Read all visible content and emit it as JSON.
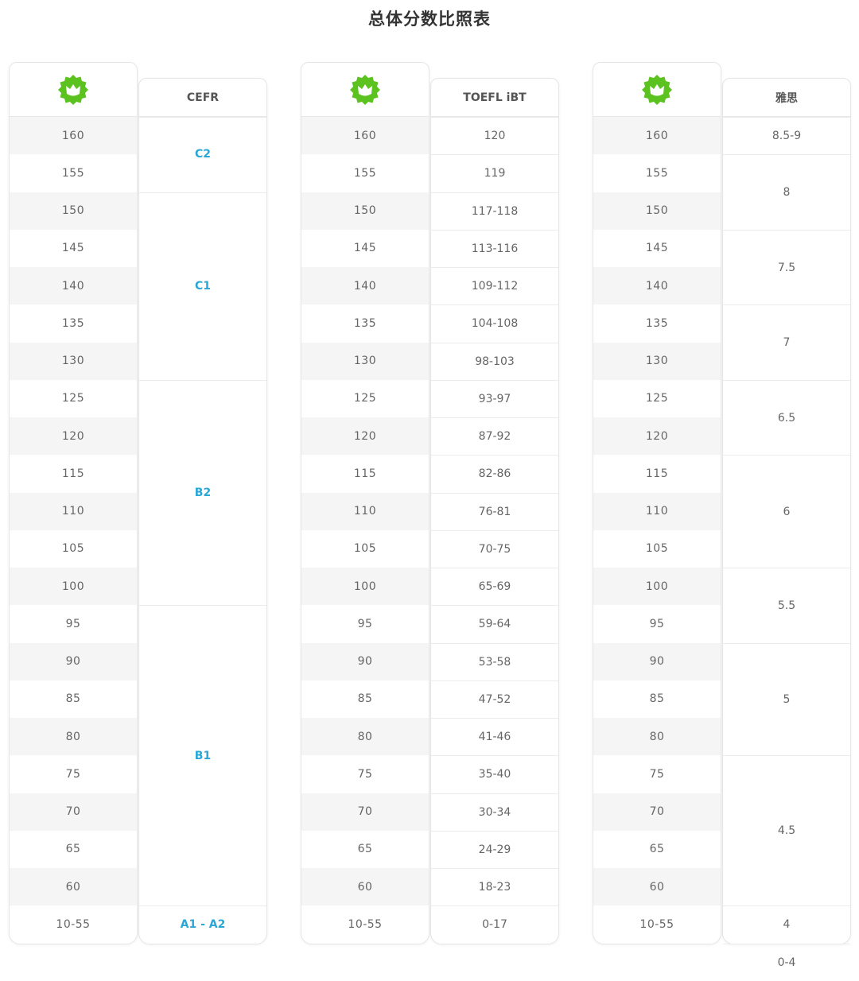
{
  "title": "总体分数比照表",
  "scores": [
    "160",
    "155",
    "150",
    "145",
    "140",
    "135",
    "130",
    "125",
    "120",
    "115",
    "110",
    "105",
    "100",
    "95",
    "90",
    "85",
    "80",
    "75",
    "70",
    "65",
    "60",
    "10-55"
  ],
  "accent": "#29a8d8",
  "logo_color": "#5cc21f",
  "tables": [
    {
      "header": "CEFR",
      "cells": [
        {
          "label": "C2",
          "span": 2
        },
        {
          "label": "C1",
          "span": 5
        },
        {
          "label": "B2",
          "span": 6
        },
        {
          "label": "B1",
          "span": 8
        },
        {
          "label": "A1 - A2",
          "span": 1
        }
      ]
    },
    {
      "header": "TOEFL iBT",
      "cells": [
        {
          "label": "120",
          "span": 1
        },
        {
          "label": "119",
          "span": 1
        },
        {
          "label": "117-118",
          "span": 1
        },
        {
          "label": "113-116",
          "span": 1
        },
        {
          "label": "109-112",
          "span": 1
        },
        {
          "label": "104-108",
          "span": 1
        },
        {
          "label": "98-103",
          "span": 1
        },
        {
          "label": "93-97",
          "span": 1
        },
        {
          "label": "87-92",
          "span": 1
        },
        {
          "label": "82-86",
          "span": 1
        },
        {
          "label": "76-81",
          "span": 1
        },
        {
          "label": "70-75",
          "span": 1
        },
        {
          "label": "65-69",
          "span": 1
        },
        {
          "label": "59-64",
          "span": 1
        },
        {
          "label": "53-58",
          "span": 1
        },
        {
          "label": "47-52",
          "span": 1
        },
        {
          "label": "41-46",
          "span": 1
        },
        {
          "label": "35-40",
          "span": 1
        },
        {
          "label": "30-34",
          "span": 1
        },
        {
          "label": "24-29",
          "span": 1
        },
        {
          "label": "18-23",
          "span": 1
        },
        {
          "label": "0-17",
          "span": 1
        }
      ]
    },
    {
      "header": "雅思",
      "cells": [
        {
          "label": "8.5-9",
          "span": 1
        },
        {
          "label": "8",
          "span": 2
        },
        {
          "label": "7.5",
          "span": 2
        },
        {
          "label": "7",
          "span": 2
        },
        {
          "label": "6.5",
          "span": 2
        },
        {
          "label": "6",
          "span": 3
        },
        {
          "label": "5.5",
          "span": 2
        },
        {
          "label": "5",
          "span": 3
        },
        {
          "label": "4.5",
          "span": 4
        },
        {
          "label": "4",
          "span": 1
        },
        {
          "label": "0-4",
          "span": 1
        }
      ]
    }
  ]
}
